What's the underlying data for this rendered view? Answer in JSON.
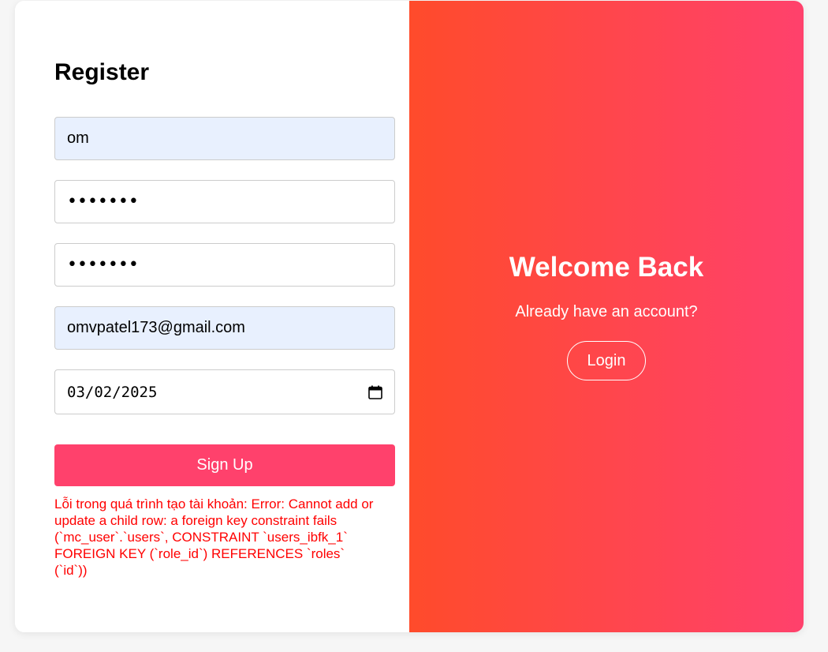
{
  "register": {
    "title": "Register",
    "username_value": "om",
    "password_value": "•••••••",
    "confirm_password_value": "•••••••",
    "email_value": "omvpatel173@gmail.com",
    "dob_value": "03/02/2025",
    "signup_label": "Sign Up",
    "error_message": "Lỗi trong quá trình tạo tài khoản: Error: Cannot add or update a child row: a foreign key constraint fails (`mc_user`.`users`, CONSTRAINT `users_ibfk_1` FOREIGN KEY (`role_id`) REFERENCES `roles` (`id`))"
  },
  "welcome": {
    "title": "Welcome Back",
    "subtitle": "Already have an account?",
    "login_label": "Login"
  },
  "icons": {
    "date_picker": "calendar-icon"
  },
  "colors": {
    "accent": "#ff416c",
    "gradient_start": "#ff4b2b",
    "gradient_end": "#ff416c",
    "error": "#ff0000",
    "autofill": "#e8f0fe"
  }
}
